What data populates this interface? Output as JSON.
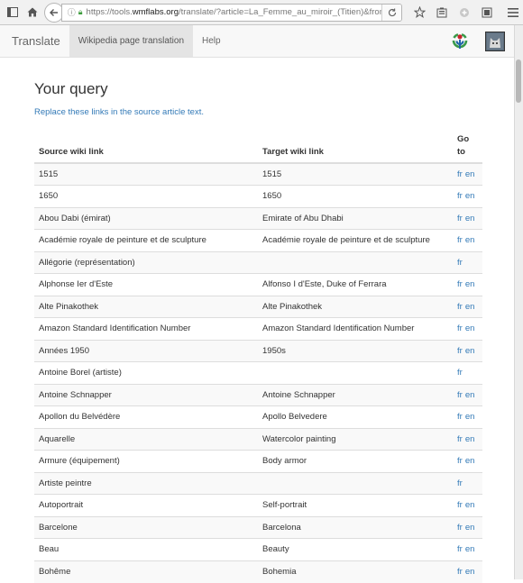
{
  "browser": {
    "url_prefix": "https://tools.",
    "url_domain": "wmflabs.org",
    "url_rest": "/translate/?article=La_Femme_au_miroir_(Titien)&from=fr&"
  },
  "header": {
    "brand": "Translate",
    "nav": [
      "Wikipedia page translation",
      "Help"
    ]
  },
  "main": {
    "title": "Your query",
    "subtitle": "Replace these links in the source article text."
  },
  "table": {
    "columns": {
      "source": "Source wiki link",
      "target": "Target wiki link",
      "go": "Go to"
    },
    "rows": [
      {
        "source": "1515",
        "target": "1515",
        "links": [
          "fr",
          "en"
        ]
      },
      {
        "source": "1650",
        "target": "1650",
        "links": [
          "fr",
          "en"
        ]
      },
      {
        "source": "Abou Dabi (émirat)",
        "target": "Emirate of Abu Dhabi",
        "links": [
          "fr",
          "en"
        ]
      },
      {
        "source": "Académie royale de peinture et de sculpture",
        "target": "Académie royale de peinture et de sculpture",
        "links": [
          "fr",
          "en"
        ]
      },
      {
        "source": "Allégorie (représentation)",
        "target": "",
        "links": [
          "fr"
        ]
      },
      {
        "source": "Alphonse Ier d'Este",
        "target": "Alfonso I d'Este, Duke of Ferrara",
        "links": [
          "fr",
          "en"
        ]
      },
      {
        "source": "Alte Pinakothek",
        "target": "Alte Pinakothek",
        "links": [
          "fr",
          "en"
        ]
      },
      {
        "source": "Amazon Standard Identification Number",
        "target": "Amazon Standard Identification Number",
        "links": [
          "fr",
          "en"
        ]
      },
      {
        "source": "Années 1950",
        "target": "1950s",
        "links": [
          "fr",
          "en"
        ]
      },
      {
        "source": "Antoine Borel (artiste)",
        "target": "",
        "links": [
          "fr"
        ]
      },
      {
        "source": "Antoine Schnapper",
        "target": "Antoine Schnapper",
        "links": [
          "fr",
          "en"
        ]
      },
      {
        "source": "Apollon du Belvédère",
        "target": "Apollo Belvedere",
        "links": [
          "fr",
          "en"
        ]
      },
      {
        "source": "Aquarelle",
        "target": "Watercolor painting",
        "links": [
          "fr",
          "en"
        ]
      },
      {
        "source": "Armure (équipement)",
        "target": "Body armor",
        "links": [
          "fr",
          "en"
        ]
      },
      {
        "source": "Artiste peintre",
        "target": "",
        "links": [
          "fr"
        ]
      },
      {
        "source": "Autoportrait",
        "target": "Self-portrait",
        "links": [
          "fr",
          "en"
        ]
      },
      {
        "source": "Barcelone",
        "target": "Barcelona",
        "links": [
          "fr",
          "en"
        ]
      },
      {
        "source": "Beau",
        "target": "Beauty",
        "links": [
          "fr",
          "en"
        ]
      },
      {
        "source": "Bohême",
        "target": "Bohemia",
        "links": [
          "fr",
          "en"
        ]
      }
    ]
  },
  "icons": {
    "sidebar": "sidebar-icon",
    "home": "home-icon",
    "back": "back-arrow-icon",
    "bookmark": "bookmark-star-icon",
    "reading_list": "reading-list-icon",
    "addon": "addon-icon",
    "screenshot": "screenshot-icon",
    "menu": "hamburger-menu-icon",
    "wikimedia": "wikimedia-logo-icon",
    "avatar": "user-avatar"
  }
}
